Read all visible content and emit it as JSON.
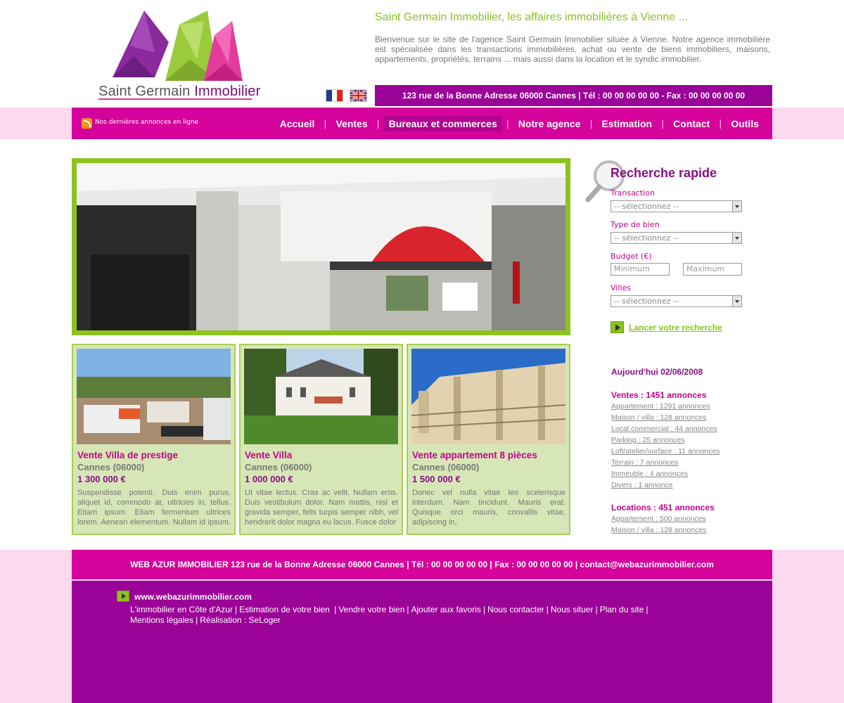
{
  "header": {
    "logo_alt": "Saint Germain Immobilier",
    "logo_text_a": "Saint Germain",
    "logo_text_b": "Immobilier",
    "tagline": "Saint Germain Immobilier, les affaires immobilières à Vienne ...",
    "intro": "Bienvenue sur le site de l'agence Saint Germain Immobilier située à Vienne. Notre agence immobilière est spécialisée dans les transactions immobilières, achat ou vente de biens immobiliers, maisons, appartements, propriétés, terrains ... mais aussi dans la location et le syndic immobilier.",
    "address_bar": "123 rue de la Bonne Adresse 06000 Cannes   |   Tél : 00 00 00 00 00   -   Fax : 00 00 00 00 00",
    "flags": [
      "french-flag-icon",
      "uk-flag-icon"
    ]
  },
  "nav": {
    "rss_label": "Nos dernières annonces en ligne",
    "items": [
      "Accueil",
      "Ventes",
      "Bureaux et commerces",
      "Notre agence",
      "Estimation",
      "Contact",
      "Outils"
    ],
    "active_index": 2
  },
  "listings": [
    {
      "title": "Vente Villa de prestige",
      "city": "Cannes (06000)",
      "price": "1 300 000 €",
      "text": "Suspendisse potenti. Duis enim purus, aliquet id, commodo at, ultricies in, tellus. Etiam ipsum. Etiam fermentum ultrices lorem. Aenean elementum. Nullam id ipsum. Integer"
    },
    {
      "title": "Vente Villa",
      "city": "Cannes (06000)",
      "price": "1 000 000 €",
      "text": "Ut vitae lectus. Cras ac velit. Nullam eros. Duis vestibulum dolor. Nam mattis, nisl et gravida semper, felis turpis semper nibh, vel hendrerit dolor magna eu lacus. Fusce dolor"
    },
    {
      "title": "Vente appartement 8 pièces",
      "city": "Cannes (06000)",
      "price": "1 500 000 €",
      "text": "Donec vel nulla vitae leo scelerisque interdum. Nam tincidunt. Mauris erat. Quisque orci mauris, convallis vitae, adipiscing in,"
    }
  ],
  "search": {
    "title": "Recherche rapide",
    "transaction_label": "Transaction",
    "transaction_value": "-- sélectionnez --",
    "type_label": "Type de bien",
    "type_value": "-- sélectionnez --",
    "budget_label": "Budget (€)",
    "budget_min_placeholder": "Minimum",
    "budget_max_placeholder": "Maximum",
    "cities_label": "Villes",
    "cities_value": "-- sélectionnez --",
    "submit_label": "Lancer votre recherche"
  },
  "stats": {
    "date": "Aujourd'hui 02/06/2008",
    "sales_head": "Ventes : 1451 annonces",
    "sales": [
      "Appartement : 1291 annonces",
      "Maison / villa : 128 annonces",
      "Local commercial : 44 annonces",
      "Parking : 25 annonces",
      "Loft/atelier/surface : 11 annonces",
      "Terrain : 7 annonces",
      "Immeuble : 4 annonces",
      "Divers : 1 annonce"
    ],
    "rent_head": "Locations : 451 annonces",
    "rent": [
      "Appartement : 500 annonces",
      "Maison / villa : 128 annonces"
    ]
  },
  "footer": {
    "bar": "WEB AZUR IMMOBILIER   123 rue de la Bonne Adresse 06000 Cannes   |   Tél : 00 00 00 00 00   |   Fax : 00 00 00 00 00   |   contact@webazurimmobilier.com",
    "site": "www.webazurimmobilier.com",
    "links": [
      "L'immobilier en Côte d'Azur",
      "Estimation de votre bien ",
      "Vendre votre bien",
      "Ajouter aux favoris",
      "Nous contacter",
      "Nous situer",
      "Plan du site",
      "Mentions légales",
      "Réalisation : SeLoger"
    ]
  },
  "colors": {
    "pink": "#d5039b",
    "purple": "#9b0297",
    "green": "#8dc21f",
    "light_pink": "#fdd9ee",
    "card_bg": "#d7e6b6"
  }
}
